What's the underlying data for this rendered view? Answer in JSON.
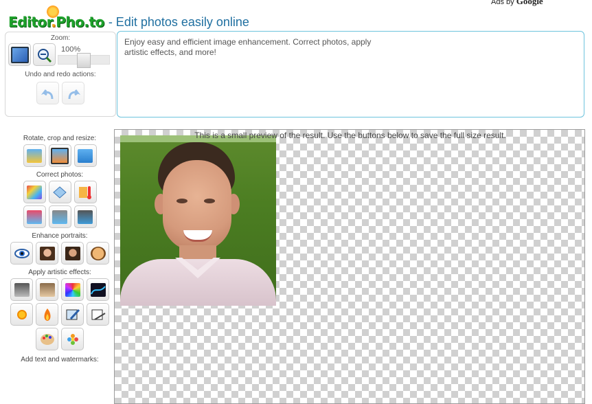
{
  "ads": {
    "label": "Ads by",
    "brand": "Google"
  },
  "header": {
    "logo": {
      "part1": "Editor",
      "part2": ".",
      "part3": "Pho.to"
    },
    "tagline": "- Edit photos easily online"
  },
  "zoom": {
    "label": "Zoom:",
    "value": "100%",
    "undo_label": "Undo and redo actions:"
  },
  "description": {
    "line1": "Enjoy easy and efficient image enhancement. Correct photos, apply",
    "line2": "artistic effects, and more!"
  },
  "tools": {
    "rotate_label": "Rotate, crop and resize:",
    "correct_label": "Correct photos:",
    "portrait_label": "Enhance portraits:",
    "artistic_label": "Apply artistic effects:",
    "text_label": "Add text and watermarks:"
  },
  "preview": {
    "note": "This is a small preview of the result. Use the buttons below to save the full size result."
  },
  "colors": {
    "accent": "#6cc3dd",
    "tagline": "#1f6fa0",
    "logo_green": "#1ea12b"
  }
}
